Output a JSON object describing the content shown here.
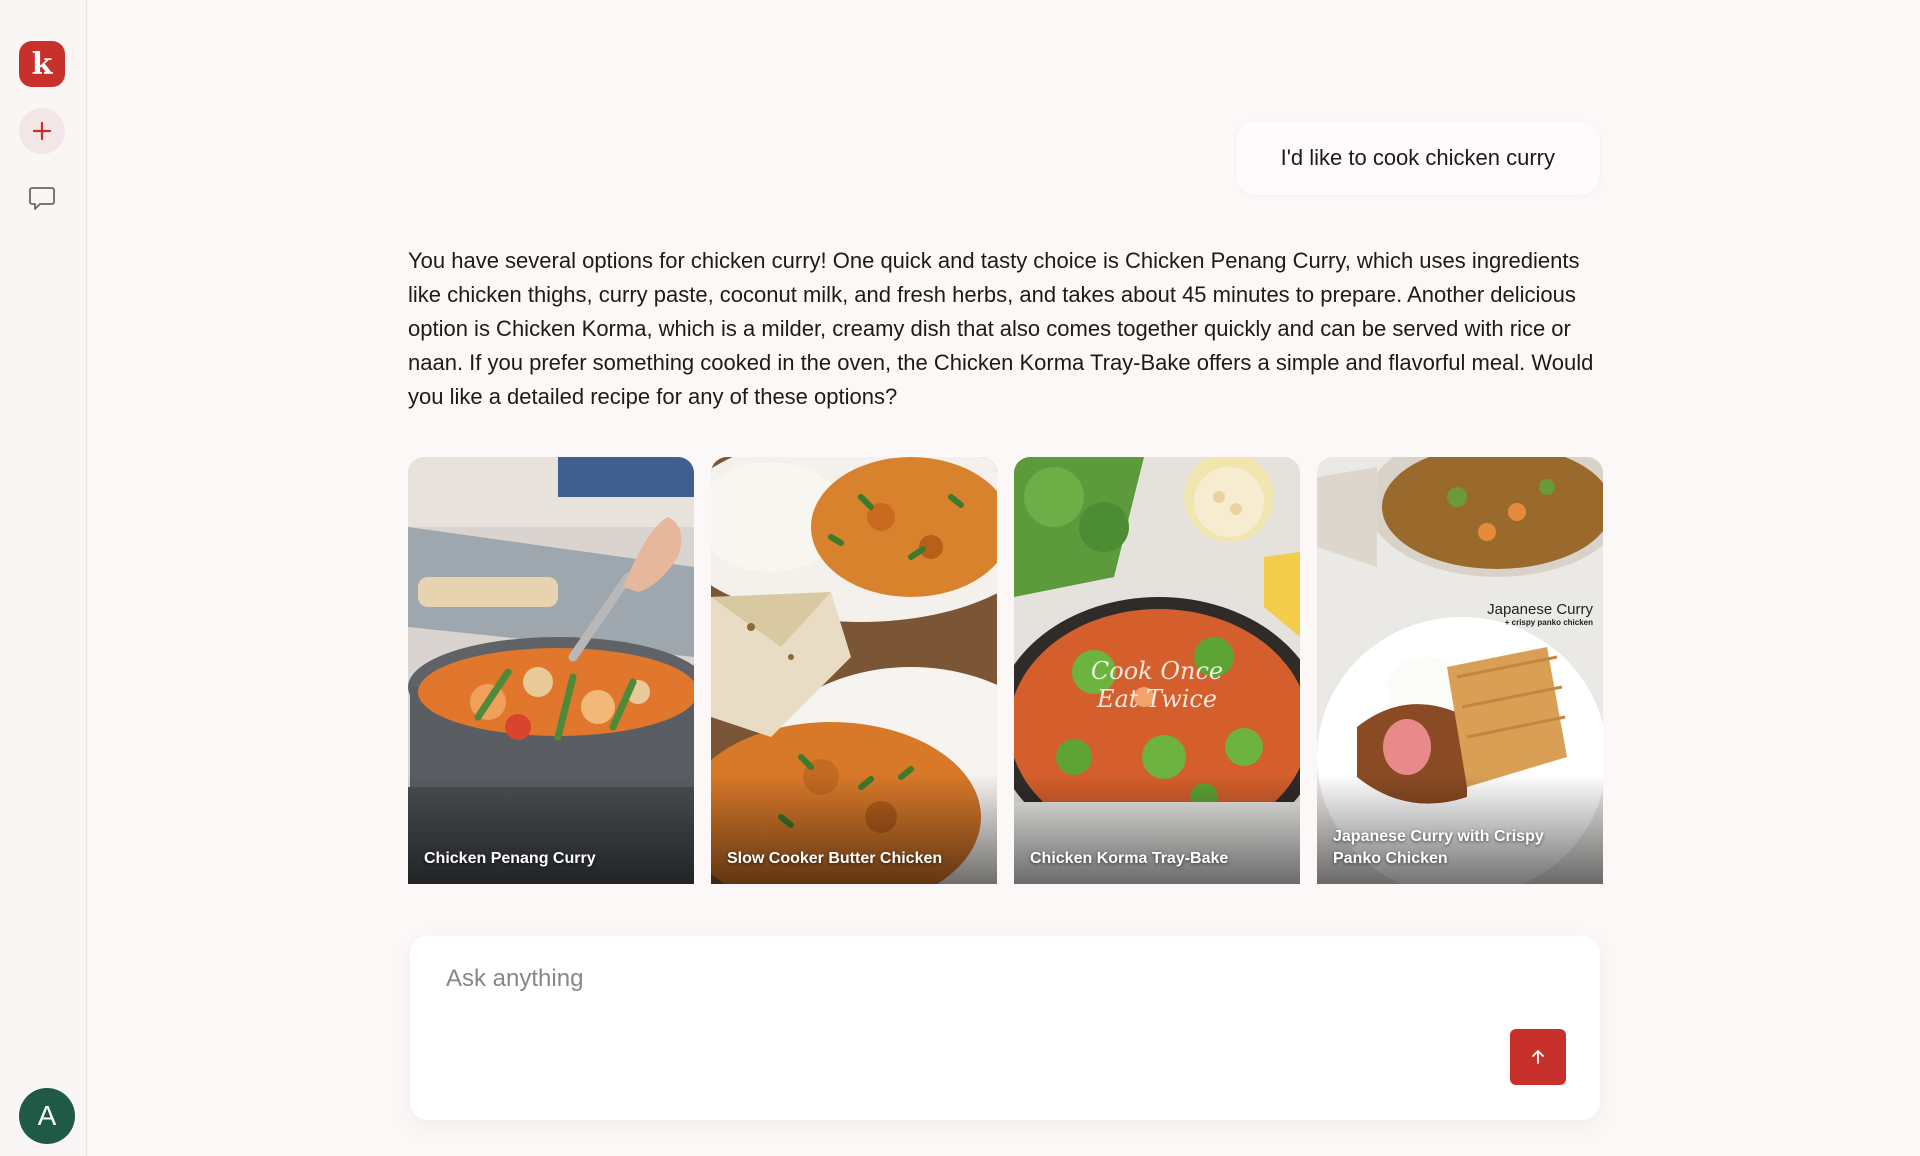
{
  "app": {
    "logo_letter": "k",
    "brand_color": "#c8302c",
    "avatar_initial": "A",
    "avatar_color": "#1e5a45"
  },
  "sidebar": {
    "icons": [
      "plus-icon",
      "chat-bubble-icon"
    ]
  },
  "conversation": {
    "user_message": "I'd like to cook chicken curry",
    "assistant_message": "You have several options for chicken curry! One quick and tasty choice is Chicken Penang Curry, which uses ingredients like chicken thighs, curry paste, coconut milk, and fresh herbs, and takes about 45 minutes to prepare. Another delicious option is Chicken Korma, which is a milder, creamy dish that also comes together quickly and can be served with rice or naan. If you prefer something cooked in the oven, the Chicken Korma Tray-Bake offers a simple and flavorful meal. Would you like a detailed recipe for any of these options?"
  },
  "recipes": [
    {
      "title": "Chicken Penang Curry"
    },
    {
      "title": "Slow Cooker Butter Chicken"
    },
    {
      "title": "Chicken Korma Tray-Bake",
      "image_text_line1": "Cook Once",
      "image_text_line2": "Eat Twice"
    },
    {
      "title": "Japanese Curry with Crispy Panko Chicken",
      "image_text_line1": "Japanese Curry",
      "image_text_line2": "+ crispy panko chicken"
    }
  ],
  "composer": {
    "placeholder": "Ask anything",
    "send_icon": "arrow-up-icon"
  }
}
